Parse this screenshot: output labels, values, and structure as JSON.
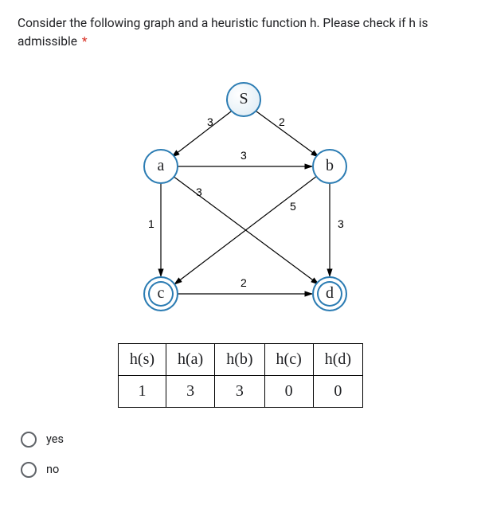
{
  "question": {
    "text": "Consider the following graph and a heuristic function h. Please check if h is admissible",
    "required_marker": "*"
  },
  "graph": {
    "nodes": {
      "s": "S",
      "a": "a",
      "b": "b",
      "c": "c",
      "d": "d"
    },
    "edge_labels": {
      "s_a": "3",
      "s_b": "2",
      "a_b": "3",
      "a_d": "3",
      "b_c": "5",
      "a_c": "1",
      "b_d": "3",
      "c_d": "2"
    }
  },
  "heuristic_table": {
    "headers": [
      "h(s)",
      "h(a)",
      "h(b)",
      "h(c)",
      "h(d)"
    ],
    "values": [
      "1",
      "3",
      "3",
      "0",
      "0"
    ]
  },
  "options": {
    "yes": "yes",
    "no": "no"
  }
}
